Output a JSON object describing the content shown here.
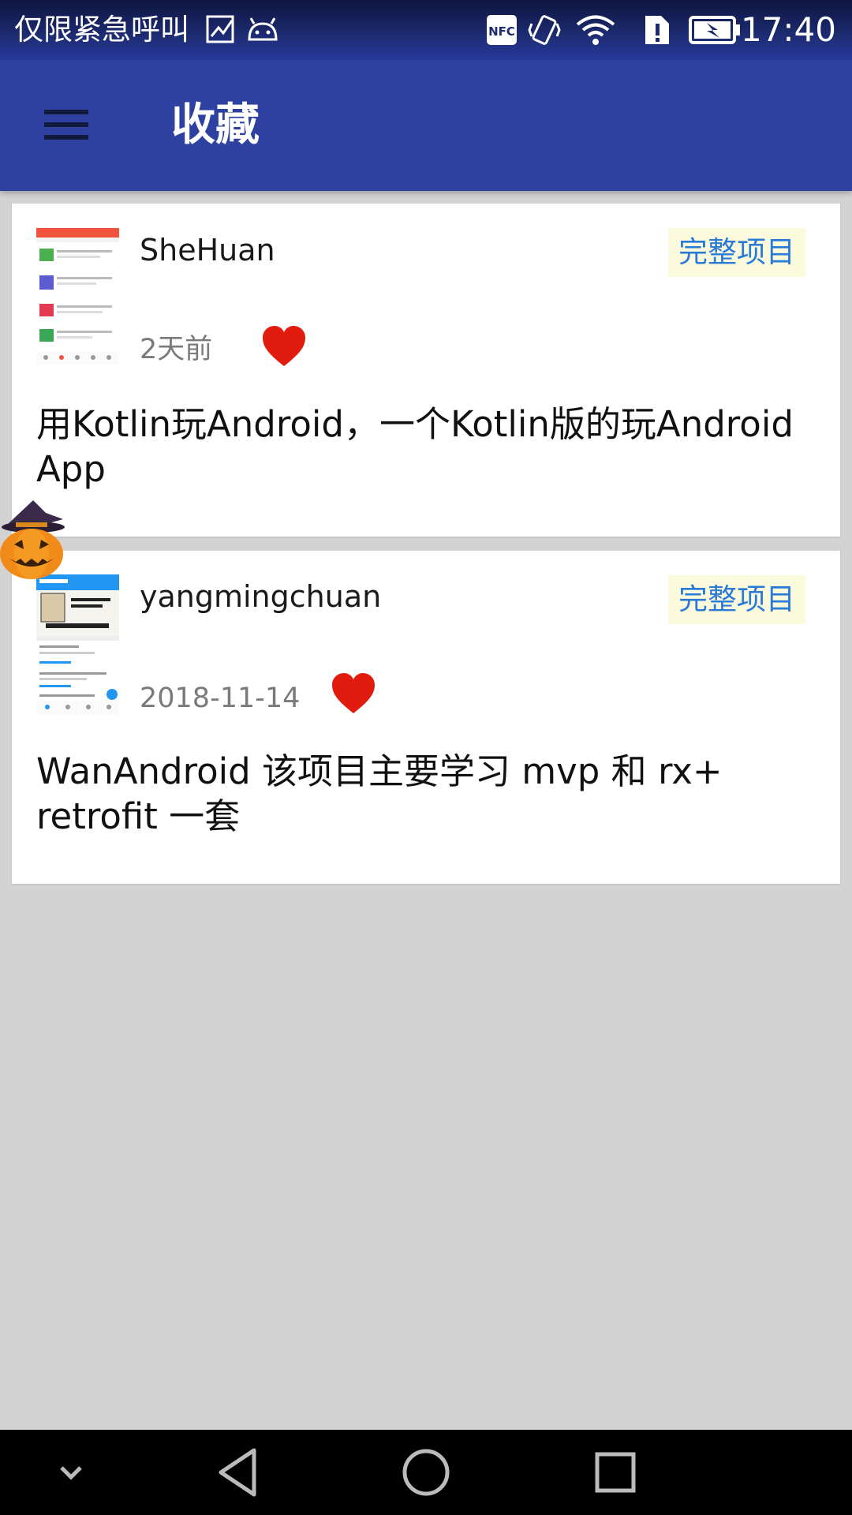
{
  "status_bar": {
    "text": "仅限紧急呼叫",
    "time": "17:40",
    "icons": [
      "image-icon",
      "android-icon",
      "nfc-icon",
      "vibrate-icon",
      "wifi-icon",
      "sim-alert-icon",
      "battery-charging-icon"
    ]
  },
  "app_bar": {
    "menu_icon": "hamburger-menu-icon",
    "title": "收藏"
  },
  "favorites": [
    {
      "author": "SheHuan",
      "tag": "完整项目",
      "date": "2天前",
      "title": "用Kotlin玩Android，一个Kotlin版的玩Android App",
      "favorite_icon": "heart-icon"
    },
    {
      "author": "yangmingchuan",
      "tag": "完整项目",
      "date": "2018-11-14",
      "title": "WanAndroid 该项目主要学习 mvp 和 rx+ retrofit 一套",
      "favorite_icon": "heart-icon"
    }
  ],
  "nav_bar": {
    "icons": [
      "chevron-down-icon",
      "back-icon",
      "home-icon",
      "recents-icon"
    ]
  },
  "colors": {
    "app_bar": "#2e40a0",
    "background": "#d3d3d3",
    "tag_text": "#2a7bd8",
    "tag_background": "#fcfadc",
    "heart": "#e21b0f"
  }
}
